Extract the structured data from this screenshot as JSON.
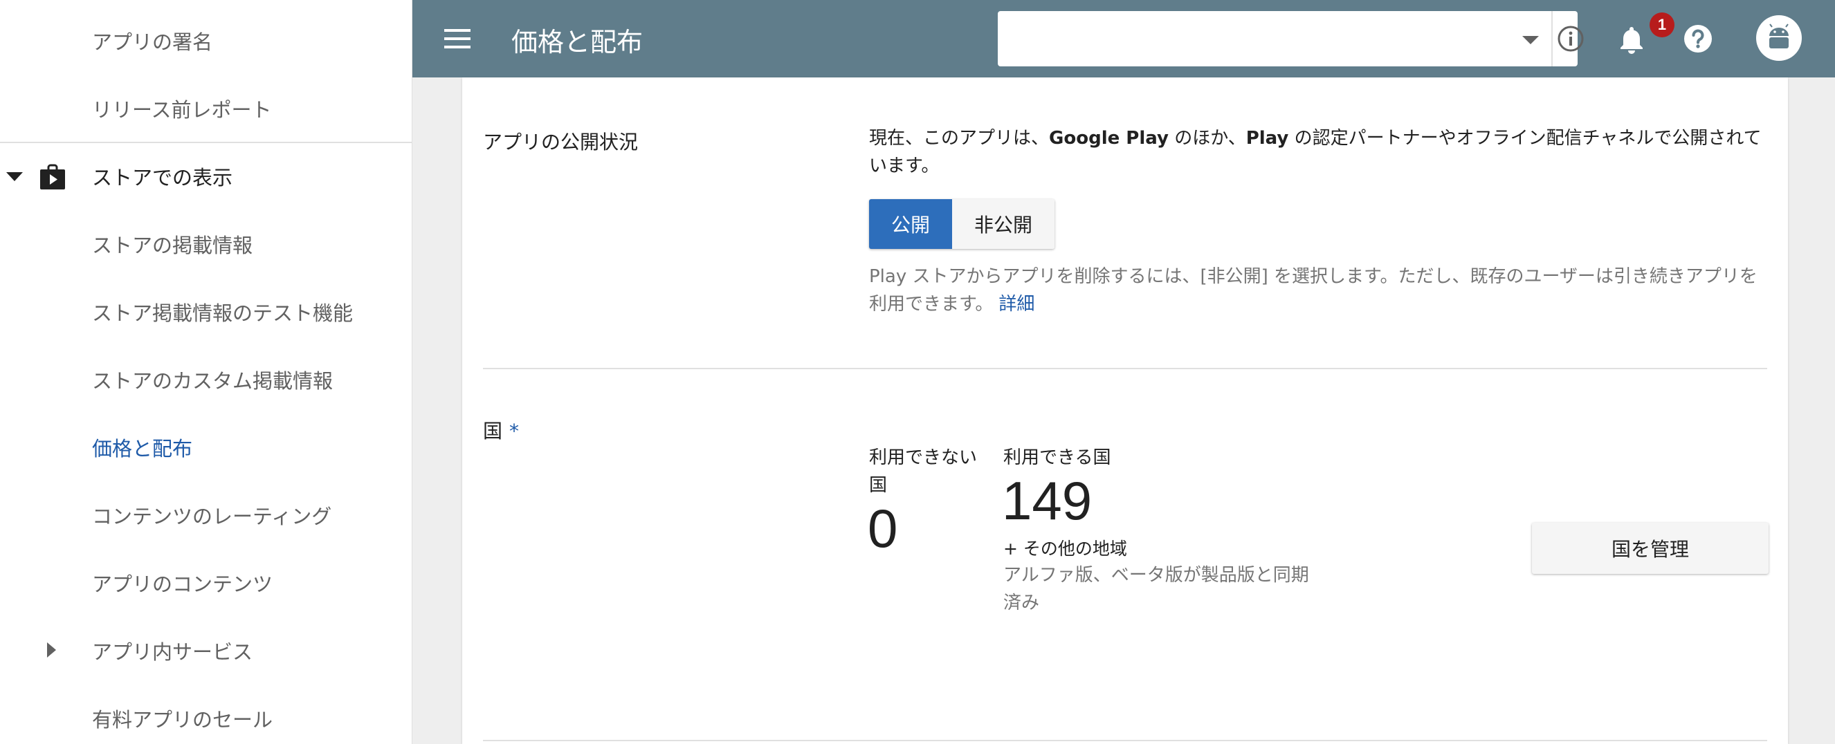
{
  "sidebar": {
    "items": [
      {
        "label": "アプリの署名"
      },
      {
        "label": "リリース前レポート"
      },
      {
        "label": "ストアでの表示"
      },
      {
        "label": "ストアの掲載情報"
      },
      {
        "label": "ストア掲載情報のテスト機能"
      },
      {
        "label": "ストアのカスタム掲載情報"
      },
      {
        "label": "価格と配布"
      },
      {
        "label": "コンテンツのレーティング"
      },
      {
        "label": "アプリのコンテンツ"
      },
      {
        "label": "アプリ内サービス"
      },
      {
        "label": "有料アプリのセール"
      }
    ],
    "active_label": "価格と配布"
  },
  "header": {
    "title": "価格と配布",
    "app_select_value": "",
    "notification_count": "1"
  },
  "visibility": {
    "label": "アプリの公開状況",
    "description_prefix": "現在、このアプリは、",
    "description_brand1": "Google Play",
    "description_mid": " のほか、",
    "description_brand2": "Play",
    "description_suffix": " の認定パートナーやオフライン配信チャネルで公開されています。",
    "option_published": "公開",
    "option_unpublished": "非公開",
    "selected": "公開",
    "help_text": "Play ストアからアプリを削除するには、[非公開] を選択します。ただし、既存のユーザーは引き続きアプリを利用できます。",
    "help_link": "詳細"
  },
  "countries": {
    "label": "国",
    "required_mark": "*",
    "unavailable_label": "利用できない国",
    "unavailable_count": "0",
    "available_label": "利用できる国",
    "available_count": "149",
    "other_regions": "+ その他の地域",
    "sync_note": "アルファ版、ベータ版が製品版と同期済み",
    "manage_button": "国を管理"
  },
  "colors": {
    "topbar": "#607d8b",
    "accent": "#1e5aa8",
    "selected_button": "#2d6ebb",
    "badge": "#b71c1c"
  },
  "icons": [
    "menu-icon",
    "dropdown-arrow-icon",
    "info-icon",
    "bell-icon",
    "help-icon",
    "android-avatar-icon",
    "store-bag-icon",
    "caret-down-icon",
    "caret-right-icon"
  ]
}
